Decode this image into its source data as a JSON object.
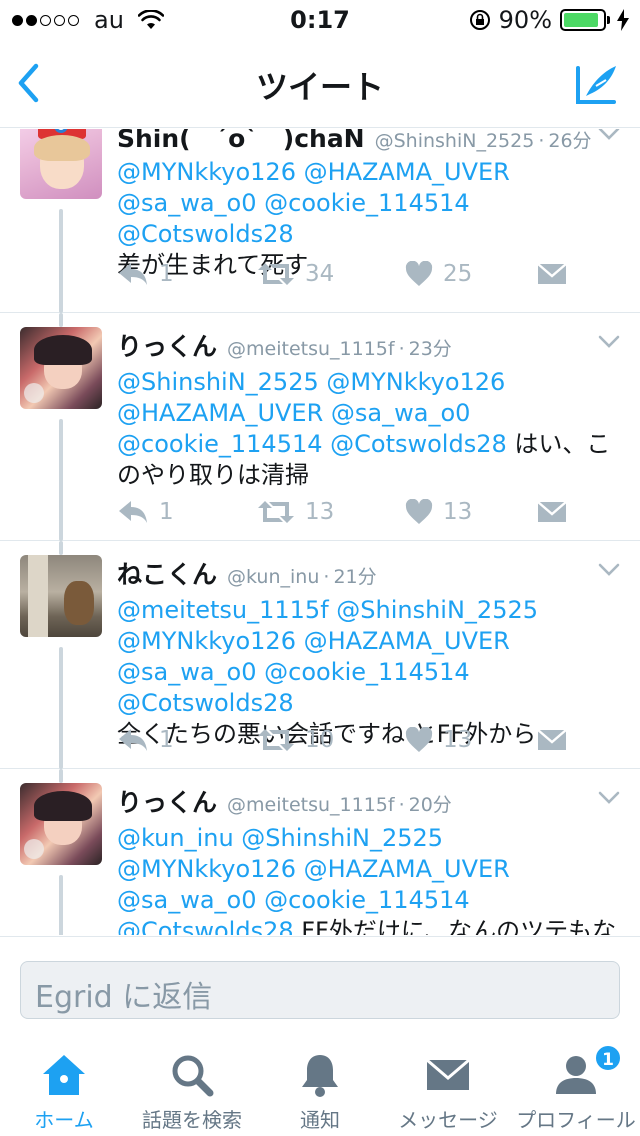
{
  "status_bar": {
    "signal_dots_filled": 2,
    "signal_dots_total": 5,
    "carrier": "au",
    "time": "0:17",
    "battery_percent": "90%",
    "battery_level": 0.9,
    "icons": [
      "wifi-icon",
      "orientation-lock-icon",
      "battery-icon",
      "charging-bolt-icon"
    ]
  },
  "nav": {
    "title": "ツイート",
    "back_icon": "chevron-left-icon",
    "compose_icon": "compose-tweet-icon"
  },
  "tweets": [
    {
      "name": "Shin(　ˊoˋ　)chaN",
      "handle": "@ShinshiN_2525",
      "time": "26分",
      "body_mentions": "@MYNkkyo126 @HAZAMA_UVER @sa_wa_o0 @cookie_114514 @Cotswolds28",
      "body_text": "差が生まれて死す",
      "replies": "1",
      "retweets": "34",
      "likes": "25"
    },
    {
      "name": "りっくん",
      "handle": "@meitetsu_1115f",
      "time": "23分",
      "body_mentions": "@ShinshiN_2525 @MYNkkyo126 @HAZAMA_UVER @sa_wa_o0 @cookie_114514 @Cotswolds28",
      "body_text": " はい、このやり取りは清掃",
      "replies": "1",
      "retweets": "13",
      "likes": "13"
    },
    {
      "name": "ねこくん",
      "handle": "@kun_inu",
      "time": "21分",
      "body_mentions": "@meitetsu_1115f @ShinshiN_2525 @MYNkkyo126 @HAZAMA_UVER @sa_wa_o0 @cookie_114514 @Cotswolds28",
      "body_text": "全くたちの悪い会話ですね とFF外から…",
      "replies": "1",
      "retweets": "10",
      "likes": "13"
    },
    {
      "name": "りっくん",
      "handle": "@meitetsu_1115f",
      "time": "20分",
      "body_mentions": "@kun_inu @ShinshiN_2525 @MYNkkyo126 @HAZAMA_UVER @sa_wa_o0 @cookie_114514 @Cotswolds28",
      "body_text": " FF外だけに、なんのツテもないところからです、とな？"
    }
  ],
  "composer": {
    "placeholder": "Egrid に返信"
  },
  "tabs": [
    {
      "label": "ホーム",
      "icon": "home-icon",
      "active": true
    },
    {
      "label": "話題を検索",
      "icon": "search-icon",
      "active": false
    },
    {
      "label": "通知",
      "icon": "bell-icon",
      "active": false
    },
    {
      "label": "メッセージ",
      "icon": "envelope-icon",
      "active": false
    },
    {
      "label": "プロフィール",
      "icon": "profile-icon",
      "active": false,
      "badge": "1"
    }
  ],
  "colors": {
    "accent": "#1da1f2",
    "text": "#14171a",
    "muted": "#8899a6",
    "action_gray": "#aab8c2",
    "battery_green": "#4cd964"
  }
}
